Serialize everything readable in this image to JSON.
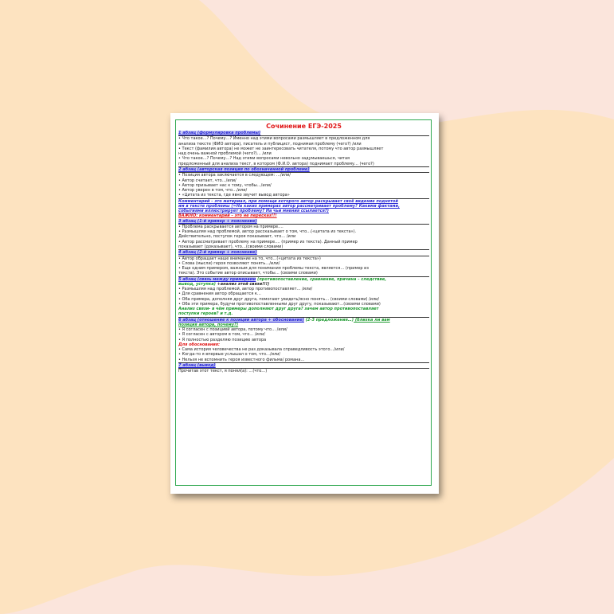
{
  "colors": {
    "background": "#fbe5dc",
    "blob": "#fde3c0",
    "frame": "#2fa84f",
    "heading_text": "#2b2bd6",
    "heading_bg": "#c9cbf6",
    "red": "#e01919",
    "green": "#1c9a2f"
  },
  "document": {
    "title": "Сочинение ЕГЭ-2025",
    "p1": {
      "heading": "1 абзац (формулировка проблемы)",
      "lines": [
        "• Что такое…? Почему…? Именно над этими вопросами размышляет в предложенном для",
        "анализа тексте (ФИО автора), писатель и публицист, поднимая проблему (чего?) /или",
        "• Текст (фамилия автора) не может не заинтересовать читателя, потому что автор размышляет",
        "над очень важной проблемой (чего?)…                      /или",
        "• Что такое…? Почему…? Над этими вопросами невольно задумываешься, читая",
        "предложенный для анализа текст, в котором (Ф.И.О. автора) поднимает проблему… (чего?)"
      ]
    },
    "p2": {
      "heading": "2 абзац (авторская позиция по обозначенной проблеме)",
      "lines": [
        "• Позиция автора заключается в следующем: …/или/",
        "• Автор считает, что…/или/",
        "• Автор призывает нас к тому, чтобы…/или/",
        "• Автор уверен в том, что…/или/",
        "• «Цитата из текста, где явно звучит вывод автора»"
      ]
    },
    "comment": {
      "lines": [
        "Комментарий – это материал, при помощи которого автор раскрывает своё видение поднятой",
        "им в тексте проблемы (=На каких примерах автор рассматривает проблему? Какими фактами,",
        "событиями иллюстрирует проблему? На чьи мнения ссылается?)"
      ],
      "important": "ВАЖНО: комментарий – это не пересказ!!!"
    },
    "p3": {
      "heading": "3 абзац (1-й пример + пояснение)",
      "lines": [
        "• Проблема раскрывается автором на примере….",
        "• Размышляя над проблемой, автор рассказывает о том, что…(«цитата из текста»).",
        "Действительно, поступок героя показывает, что… /или",
        "• Автор рассматривает проблему на примере…. (пример из текста). Данный пример",
        "показывает (доказывает), что…(своими словами)"
      ]
    },
    "p4": {
      "heading": "4 абзац (2-й пример + пояснение)",
      "lines": [
        "• Автор обращает наше внимание на то, что…(«цитата из текста»)",
        "• Слова (мысли) героя позволяют понять…/или/",
        "• Еще одним примером, важным для понимания проблемы текста, является… (пример из",
        "текста). Это событие автор описывает, чтобы… (своими словами)"
      ]
    },
    "p5": {
      "heading": "5 абзац (связь между примерами",
      "heading_green": " (противопоставление, сравнение, причина – следствие,",
      "heading_green2": "вывод, уступка)",
      "heading_tail": " +анализ этой связи!!!)",
      "lines": [
        "• Размышляя над проблемой, автор противопоставляет…  /или/",
        "• Для сравнения автор обращается к…",
        "• Оба примера, дополняя друг друга, помогают увидеть/ясно понять… (своими словами) /или/",
        "• Оба эти примера, будучи противопоставленными друг другу, показывают…(своими словами)"
      ],
      "analysis": [
        "Анализ связи- в чём примеры дополняют друг друга? зачем автор противопоставляет",
        "поступки героев? и т.д."
      ]
    },
    "p6": {
      "heading": "6 абзац (отношение к позиции автора + обоснование)",
      "heading_green": " (2-3 предложения…)",
      "heading_green_u": " (близка ли вам",
      "heading_line2": "позиция автора, почему?)",
      "lines": [
        "• Я согласен с позицией автора, потому что… /или/",
        "• Я согласен с автором в том, что…  /или/",
        "• Я полностью разделяю позицию автора"
      ],
      "justify_label": "Для обоснования:",
      "justify_lines": [
        "• Сама история человечества не раз доказывала справедливость этого…/или/",
        "• Когда-то я впервые услышал о том, что…/или/",
        "• Нельзя не вспомнить героя известного фильма/ романа…"
      ]
    },
    "p7": {
      "heading": "7 абзац (вывод)",
      "lines": [
        "Прочитав этот текст, я понял(а): …(что…)"
      ]
    }
  }
}
